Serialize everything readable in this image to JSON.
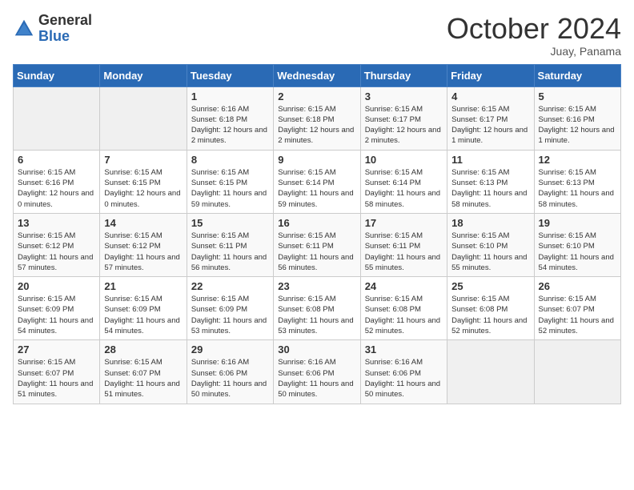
{
  "logo": {
    "general": "General",
    "blue": "Blue"
  },
  "header": {
    "month": "October 2024",
    "location": "Juay, Panama"
  },
  "weekdays": [
    "Sunday",
    "Monday",
    "Tuesday",
    "Wednesday",
    "Thursday",
    "Friday",
    "Saturday"
  ],
  "weeks": [
    [
      {
        "day": "",
        "info": ""
      },
      {
        "day": "",
        "info": ""
      },
      {
        "day": "1",
        "info": "Sunrise: 6:16 AM\nSunset: 6:18 PM\nDaylight: 12 hours and 2 minutes."
      },
      {
        "day": "2",
        "info": "Sunrise: 6:15 AM\nSunset: 6:18 PM\nDaylight: 12 hours and 2 minutes."
      },
      {
        "day": "3",
        "info": "Sunrise: 6:15 AM\nSunset: 6:17 PM\nDaylight: 12 hours and 2 minutes."
      },
      {
        "day": "4",
        "info": "Sunrise: 6:15 AM\nSunset: 6:17 PM\nDaylight: 12 hours and 1 minute."
      },
      {
        "day": "5",
        "info": "Sunrise: 6:15 AM\nSunset: 6:16 PM\nDaylight: 12 hours and 1 minute."
      }
    ],
    [
      {
        "day": "6",
        "info": "Sunrise: 6:15 AM\nSunset: 6:16 PM\nDaylight: 12 hours and 0 minutes."
      },
      {
        "day": "7",
        "info": "Sunrise: 6:15 AM\nSunset: 6:15 PM\nDaylight: 12 hours and 0 minutes."
      },
      {
        "day": "8",
        "info": "Sunrise: 6:15 AM\nSunset: 6:15 PM\nDaylight: 11 hours and 59 minutes."
      },
      {
        "day": "9",
        "info": "Sunrise: 6:15 AM\nSunset: 6:14 PM\nDaylight: 11 hours and 59 minutes."
      },
      {
        "day": "10",
        "info": "Sunrise: 6:15 AM\nSunset: 6:14 PM\nDaylight: 11 hours and 58 minutes."
      },
      {
        "day": "11",
        "info": "Sunrise: 6:15 AM\nSunset: 6:13 PM\nDaylight: 11 hours and 58 minutes."
      },
      {
        "day": "12",
        "info": "Sunrise: 6:15 AM\nSunset: 6:13 PM\nDaylight: 11 hours and 58 minutes."
      }
    ],
    [
      {
        "day": "13",
        "info": "Sunrise: 6:15 AM\nSunset: 6:12 PM\nDaylight: 11 hours and 57 minutes."
      },
      {
        "day": "14",
        "info": "Sunrise: 6:15 AM\nSunset: 6:12 PM\nDaylight: 11 hours and 57 minutes."
      },
      {
        "day": "15",
        "info": "Sunrise: 6:15 AM\nSunset: 6:11 PM\nDaylight: 11 hours and 56 minutes."
      },
      {
        "day": "16",
        "info": "Sunrise: 6:15 AM\nSunset: 6:11 PM\nDaylight: 11 hours and 56 minutes."
      },
      {
        "day": "17",
        "info": "Sunrise: 6:15 AM\nSunset: 6:11 PM\nDaylight: 11 hours and 55 minutes."
      },
      {
        "day": "18",
        "info": "Sunrise: 6:15 AM\nSunset: 6:10 PM\nDaylight: 11 hours and 55 minutes."
      },
      {
        "day": "19",
        "info": "Sunrise: 6:15 AM\nSunset: 6:10 PM\nDaylight: 11 hours and 54 minutes."
      }
    ],
    [
      {
        "day": "20",
        "info": "Sunrise: 6:15 AM\nSunset: 6:09 PM\nDaylight: 11 hours and 54 minutes."
      },
      {
        "day": "21",
        "info": "Sunrise: 6:15 AM\nSunset: 6:09 PM\nDaylight: 11 hours and 54 minutes."
      },
      {
        "day": "22",
        "info": "Sunrise: 6:15 AM\nSunset: 6:09 PM\nDaylight: 11 hours and 53 minutes."
      },
      {
        "day": "23",
        "info": "Sunrise: 6:15 AM\nSunset: 6:08 PM\nDaylight: 11 hours and 53 minutes."
      },
      {
        "day": "24",
        "info": "Sunrise: 6:15 AM\nSunset: 6:08 PM\nDaylight: 11 hours and 52 minutes."
      },
      {
        "day": "25",
        "info": "Sunrise: 6:15 AM\nSunset: 6:08 PM\nDaylight: 11 hours and 52 minutes."
      },
      {
        "day": "26",
        "info": "Sunrise: 6:15 AM\nSunset: 6:07 PM\nDaylight: 11 hours and 52 minutes."
      }
    ],
    [
      {
        "day": "27",
        "info": "Sunrise: 6:15 AM\nSunset: 6:07 PM\nDaylight: 11 hours and 51 minutes."
      },
      {
        "day": "28",
        "info": "Sunrise: 6:15 AM\nSunset: 6:07 PM\nDaylight: 11 hours and 51 minutes."
      },
      {
        "day": "29",
        "info": "Sunrise: 6:16 AM\nSunset: 6:06 PM\nDaylight: 11 hours and 50 minutes."
      },
      {
        "day": "30",
        "info": "Sunrise: 6:16 AM\nSunset: 6:06 PM\nDaylight: 11 hours and 50 minutes."
      },
      {
        "day": "31",
        "info": "Sunrise: 6:16 AM\nSunset: 6:06 PM\nDaylight: 11 hours and 50 minutes."
      },
      {
        "day": "",
        "info": ""
      },
      {
        "day": "",
        "info": ""
      }
    ]
  ]
}
